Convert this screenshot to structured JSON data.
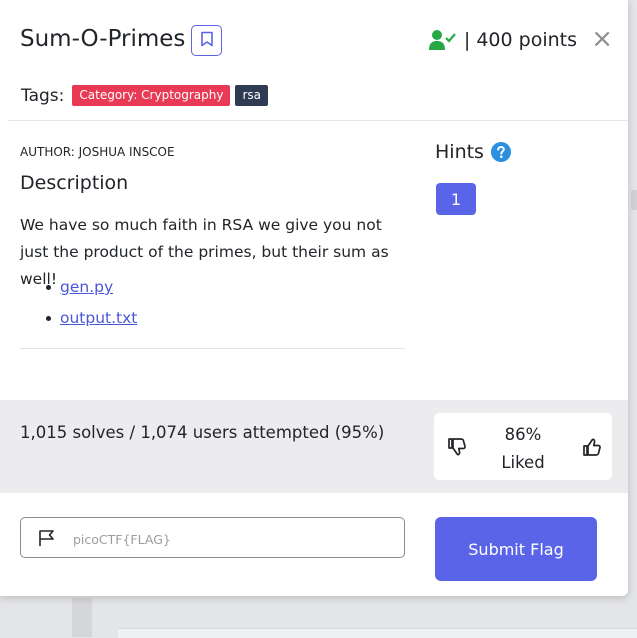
{
  "challenge": {
    "title": "Sum-O-Primes",
    "points_text": "| 400 points",
    "close_glyph": "×"
  },
  "tags": {
    "label": "Tags:",
    "items": [
      {
        "text": "Category: Cryptography",
        "color": "#e83a54"
      },
      {
        "text": "rsa",
        "color": "#2f3b52"
      }
    ]
  },
  "description": {
    "author": "AUTHOR: JOSHUA INSCOE",
    "heading": "Description",
    "text": "We have so much faith in RSA we give you not just the product of the primes, but their sum as well!",
    "files": [
      "gen.py",
      "output.txt"
    ]
  },
  "hints": {
    "heading": "Hints",
    "buttons": [
      "1"
    ]
  },
  "stats": {
    "solves_text": "1,015 solves / 1,074 users attempted (95%)",
    "liked_percent": "86%",
    "liked_label": "Liked"
  },
  "flag": {
    "placeholder": "picoCTF{FLAG}",
    "value": "",
    "submit_label": "Submit Flag"
  },
  "colors": {
    "accent": "#5a64e8",
    "success": "#28a745",
    "info": "#2d8fe0",
    "link": "#4a57d9"
  },
  "icons": [
    "bookmark-icon",
    "user-check-icon",
    "close-icon",
    "help-icon",
    "thumbs-down-icon",
    "thumbs-up-icon",
    "flag-icon"
  ]
}
